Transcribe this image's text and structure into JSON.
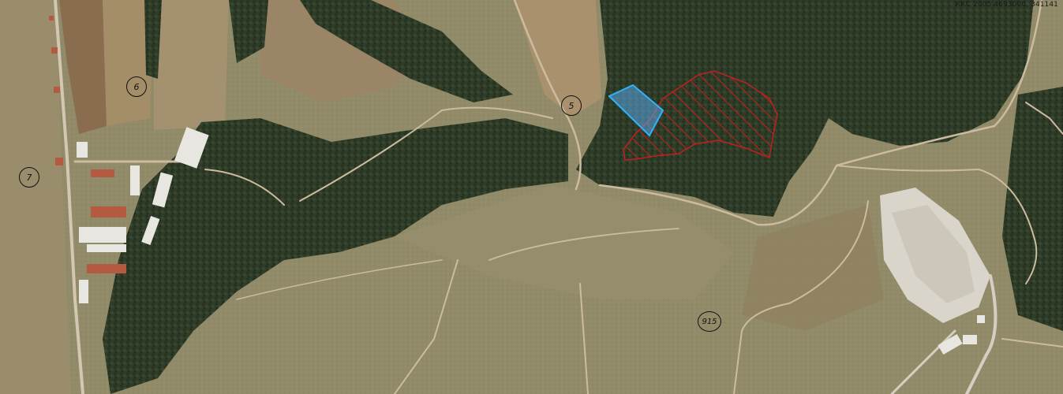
{
  "coord_readout": "ККС 2005 4693000, 341141",
  "markers": [
    {
      "name": "parcel-number-6",
      "label": "6"
    },
    {
      "name": "parcel-number-7",
      "label": "7"
    },
    {
      "name": "parcel-number-5",
      "label": "5"
    },
    {
      "name": "parcel-number-915",
      "label": "915"
    }
  ],
  "colors": {
    "hatched_area": "#c0201f",
    "highlight_area_stroke": "#2fb3ff",
    "highlight_area_fill": "#5aa7e8",
    "forest": "#2d3b27",
    "grass": "#8f8a68",
    "dry_field": "#a8956d",
    "road": "#cdbba0",
    "landfill": "#d9d5cb"
  }
}
